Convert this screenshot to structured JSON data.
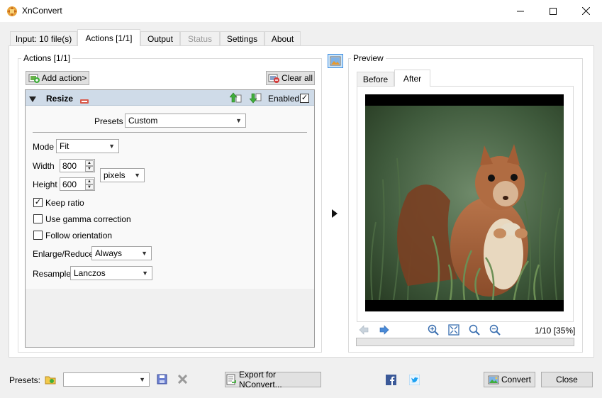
{
  "window": {
    "title": "XnConvert"
  },
  "tabs": [
    {
      "label": "Input: 10 file(s)"
    },
    {
      "label": "Actions [1/1]"
    },
    {
      "label": "Output"
    },
    {
      "label": "Status"
    },
    {
      "label": "Settings"
    },
    {
      "label": "About"
    }
  ],
  "actions": {
    "group_label": "Actions [1/1]",
    "add_action_label": "Add action>",
    "clear_all_label": "Clear all",
    "resize": {
      "title": "Resize",
      "enabled_label": "Enabled",
      "enabled": true,
      "presets_label": "Presets",
      "presets_value": "Custom",
      "mode_label": "Mode",
      "mode_value": "Fit",
      "width_label": "Width",
      "width_value": "800",
      "height_label": "Height",
      "height_value": "600",
      "unit_value": "pixels",
      "keep_ratio_label": "Keep ratio",
      "keep_ratio": true,
      "gamma_label": "Use gamma correction",
      "gamma": false,
      "orientation_label": "Follow orientation",
      "orientation": false,
      "enlarge_label": "Enlarge/Reduce",
      "enlarge_value": "Always",
      "resample_label": "Resample",
      "resample_value": "Lanczos"
    }
  },
  "preview": {
    "group_label": "Preview",
    "tabs": [
      {
        "label": "Before"
      },
      {
        "label": "After"
      }
    ],
    "page_info": "1/10 [35%]"
  },
  "footer": {
    "presets_label": "Presets:",
    "presets_value": "",
    "export_label": "Export for NConvert...",
    "convert_label": "Convert",
    "close_label": "Close"
  },
  "colors": {
    "accent": "#cfdbe8",
    "arrow_green": "#3fae3a",
    "arrow_blue": "#3b78c8",
    "facebook": "#3b5998",
    "twitter": "#1da1f2"
  }
}
